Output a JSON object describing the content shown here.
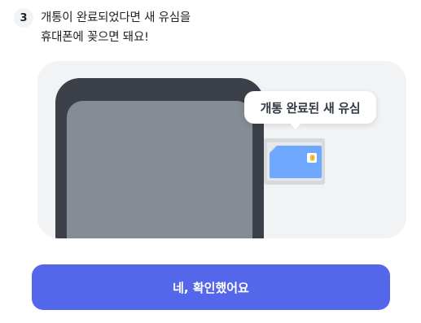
{
  "step": {
    "number": "3",
    "line1": "개통이 완료되었다면 새 유심을",
    "line2": "휴대폰에 꽂으면 돼요!"
  },
  "illustration": {
    "bubble_label": "개통 완료된 새 유심",
    "sim_icon": "sim-card-icon"
  },
  "confirm_button": {
    "label": "네, 확인했어요"
  },
  "colors": {
    "accent": "#5467ea",
    "sim": "#6fa9ff",
    "phone_frame": "#3c4149",
    "phone_screen": "#868c94",
    "panel_bg": "#f2f3f5"
  }
}
